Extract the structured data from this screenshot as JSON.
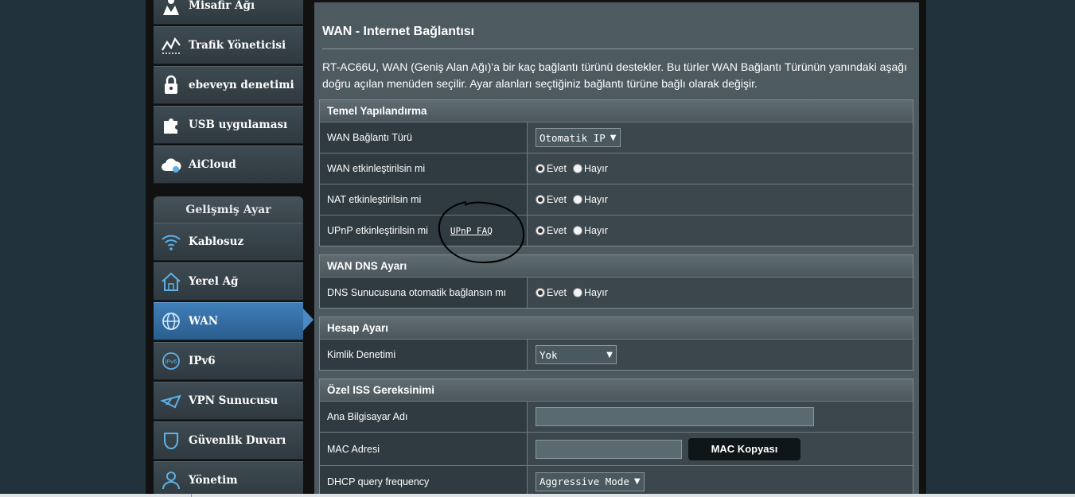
{
  "sidebar": {
    "items_top": [
      {
        "label": "Misafir Ağı",
        "icon": "guest-network-icon"
      },
      {
        "label": "Trafik Yöneticisi",
        "icon": "traffic-manager-icon"
      },
      {
        "label": "ebeveyn denetimi",
        "icon": "lock-icon"
      },
      {
        "label": "USB uygulaması",
        "icon": "puzzle-icon"
      },
      {
        "label": "AiCloud",
        "icon": "cloud-icon"
      }
    ],
    "advanced_header": "Gelişmiş Ayar",
    "items_advanced": [
      {
        "label": "Kablosuz",
        "icon": "wifi-icon"
      },
      {
        "label": "Yerel Ağ",
        "icon": "home-icon"
      },
      {
        "label": "WAN",
        "icon": "globe-icon",
        "active": true
      },
      {
        "label": "IPv6",
        "icon": "ipv6-icon"
      },
      {
        "label": "VPN Sunucusu",
        "icon": "vpn-icon"
      },
      {
        "label": "Güvenlik Duvarı",
        "icon": "shield-icon"
      },
      {
        "label": "Yönetim",
        "icon": "admin-user-icon"
      }
    ]
  },
  "main": {
    "title": "WAN - Internet Bağlantısı",
    "description": "RT-AC66U, WAN (Geniş Alan Ağı)'a bir kaç bağlantı türünü destekler. Bu türler WAN Bağlantı Türünün yanındaki aşağı doğru açılan menüden seçilir. Ayar alanları seçtiğiniz bağlantı türüne bağlı olarak değişir."
  },
  "radio": {
    "yes": "Evet",
    "no": "Hayır"
  },
  "basic": {
    "header": "Temel Yapılandırma",
    "wan_type_label": "WAN Bağlantı Türü",
    "wan_type_value": "Otomatik IP",
    "wan_enable_label": "WAN etkinleştirilsin mi",
    "nat_enable_label": "NAT etkinleştirilsin mi",
    "upnp_enable_label": "UPnP etkinleştirilsin mi",
    "upnp_faq": "UPnP FAQ"
  },
  "dns": {
    "header": "WAN DNS Ayarı",
    "auto_dns_label": "DNS Sunucusuna otomatik bağlansın mı"
  },
  "account": {
    "header": "Hesap Ayarı",
    "auth_label": "Kimlik Denetimi",
    "auth_value": "Yok"
  },
  "isp": {
    "header": "Özel ISS Gereksinimi",
    "hostname_label": "Ana Bilgisayar Adı",
    "hostname_value": "",
    "mac_label": "MAC Adresi",
    "mac_value": "",
    "mac_clone_button": "MAC Kopyası",
    "dhcp_freq_label": "DHCP query frequency",
    "dhcp_freq_value": "Aggressive Mode"
  },
  "colors": {
    "active_nav": "#3f7fb8",
    "panel_bg": "#4d5a60",
    "label_bg": "#2f3b41"
  }
}
